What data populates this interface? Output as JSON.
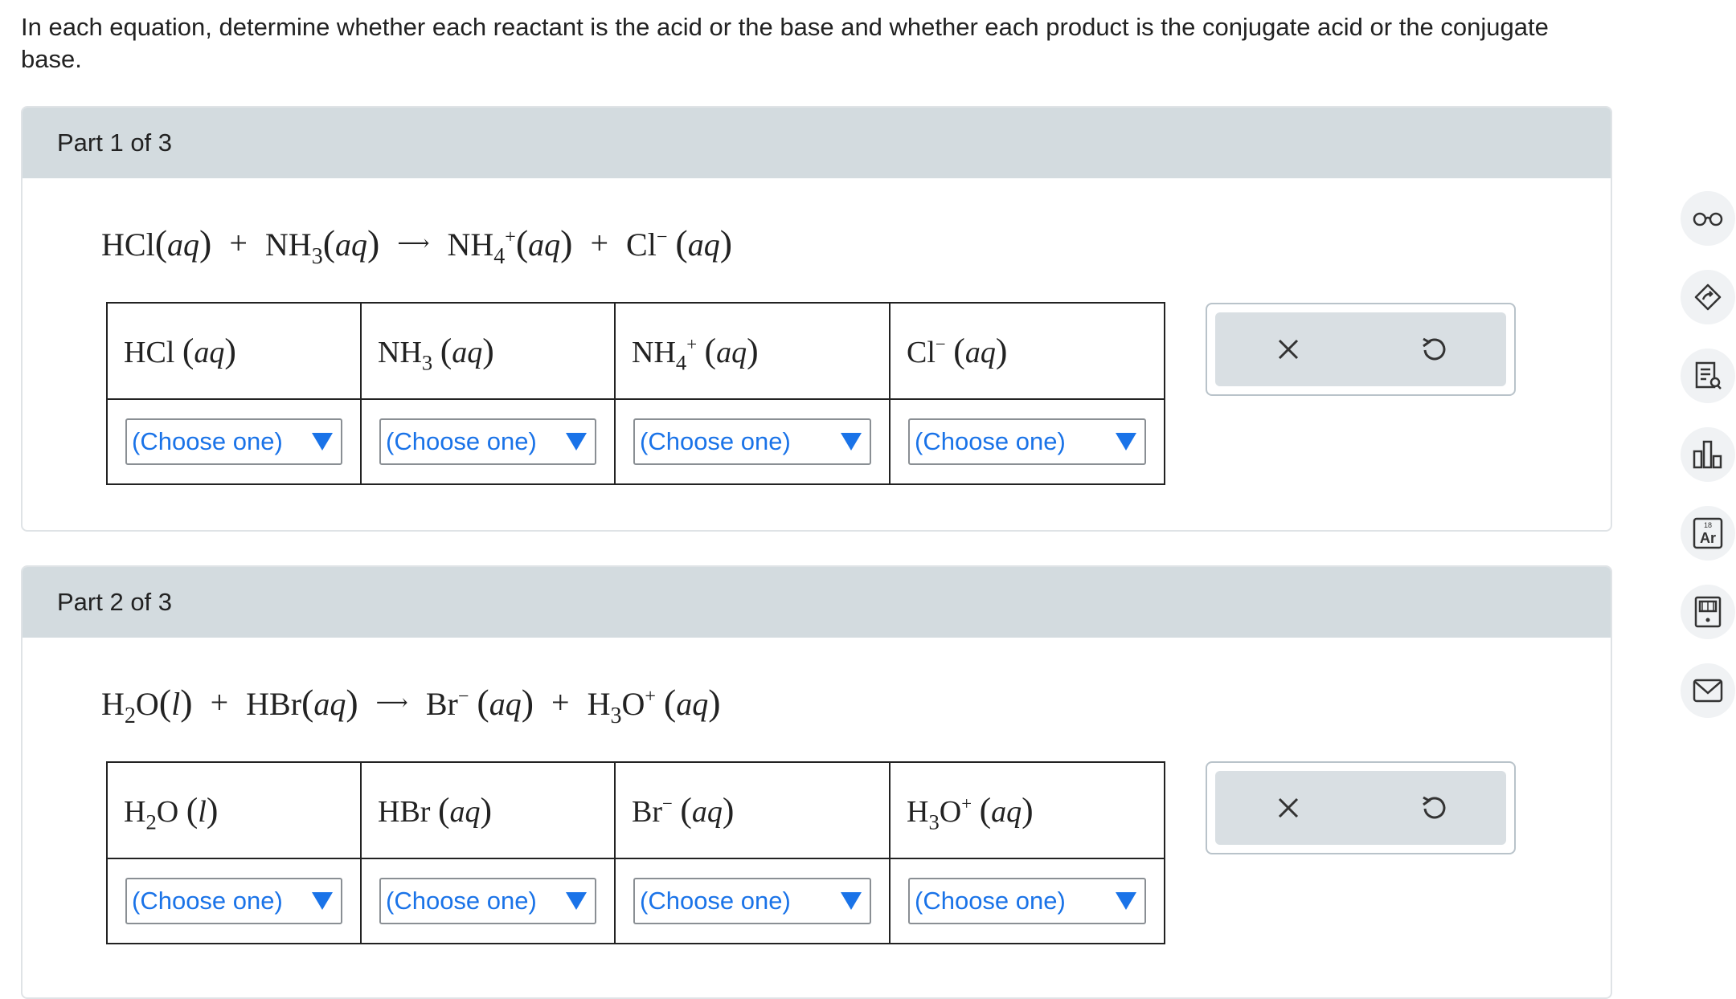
{
  "instructions": "In each equation, determine whether each reactant is the acid or the base and whether each product is the conjugate acid or the conjugate base.",
  "dropdown_default": "(Choose one)",
  "parts": [
    {
      "header": "Part 1 of 3",
      "equation": {
        "terms": [
          "HCl",
          "NH3",
          "NH4+",
          "Cl−"
        ],
        "phase_labels": [
          "aq",
          "aq",
          "aq",
          "aq"
        ]
      },
      "columns": [
        {
          "species": "HCl",
          "phase": "aq",
          "selected": "(Choose one)"
        },
        {
          "species": "NH3",
          "phase": "aq",
          "selected": "(Choose one)"
        },
        {
          "species": "NH4+",
          "phase": "aq",
          "selected": "(Choose one)"
        },
        {
          "species": "Cl−",
          "phase": "aq",
          "selected": "(Choose one)"
        }
      ]
    },
    {
      "header": "Part 2 of 3",
      "equation": {
        "terms": [
          "H2O",
          "HBr",
          "Br−",
          "H3O+"
        ],
        "phase_labels": [
          "l",
          "aq",
          "aq",
          "aq"
        ]
      },
      "columns": [
        {
          "species": "H2O",
          "phase": "l",
          "selected": "(Choose one)"
        },
        {
          "species": "HBr",
          "phase": "aq",
          "selected": "(Choose one)"
        },
        {
          "species": "Br−",
          "phase": "aq",
          "selected": "(Choose one)"
        },
        {
          "species": "H3O+",
          "phase": "aq",
          "selected": "(Choose one)"
        }
      ]
    }
  ],
  "symbols": {
    "plus": "+",
    "open_paren": "(",
    "close_paren": ")"
  },
  "actions": [
    "clear-icon",
    "undo-icon"
  ],
  "sidebar_tools": [
    "glasses-icon",
    "tag-icon",
    "notes-icon",
    "chart-icon",
    "periodic-table-icon",
    "calculator-icon",
    "mail-icon"
  ],
  "periodic_icon": {
    "number": "18",
    "symbol": "Ar"
  },
  "colors": {
    "accent": "#1a73e8",
    "header_bg": "#d3dbdf",
    "action_bg": "#d9dfe3"
  }
}
